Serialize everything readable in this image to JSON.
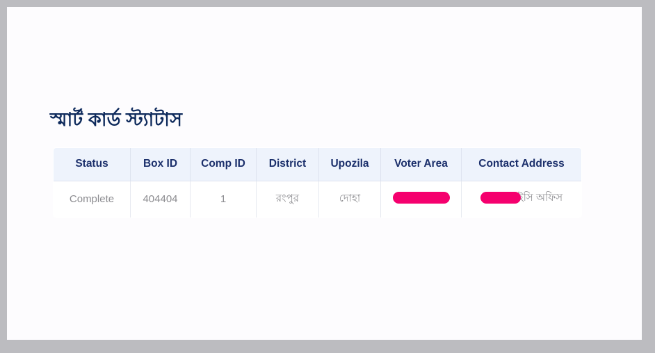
{
  "page": {
    "title": "স্মার্ট কার্ড স্ট্যাটাস"
  },
  "table": {
    "headers": [
      "Status",
      "Box ID",
      "Comp ID",
      "District",
      "Upozila",
      "Voter Area",
      "Contact Address"
    ],
    "rows": [
      {
        "status": "Complete",
        "box_id": "404404",
        "comp_id": "1",
        "district": "রংপুর",
        "upozila": "দোহা",
        "voter_area": "",
        "contact_address_visible": "ইসি অফিস"
      }
    ]
  },
  "colors": {
    "frame_border": "#bcbcc0",
    "page_background": "#fdfcfe",
    "title_text": "#0e2a5c",
    "table_header_background": "#eef3fc",
    "table_header_text": "#1b2f6b",
    "table_body_text": "#8c8c90",
    "table_border": "#dde3ef",
    "redaction": "#f5006e"
  }
}
